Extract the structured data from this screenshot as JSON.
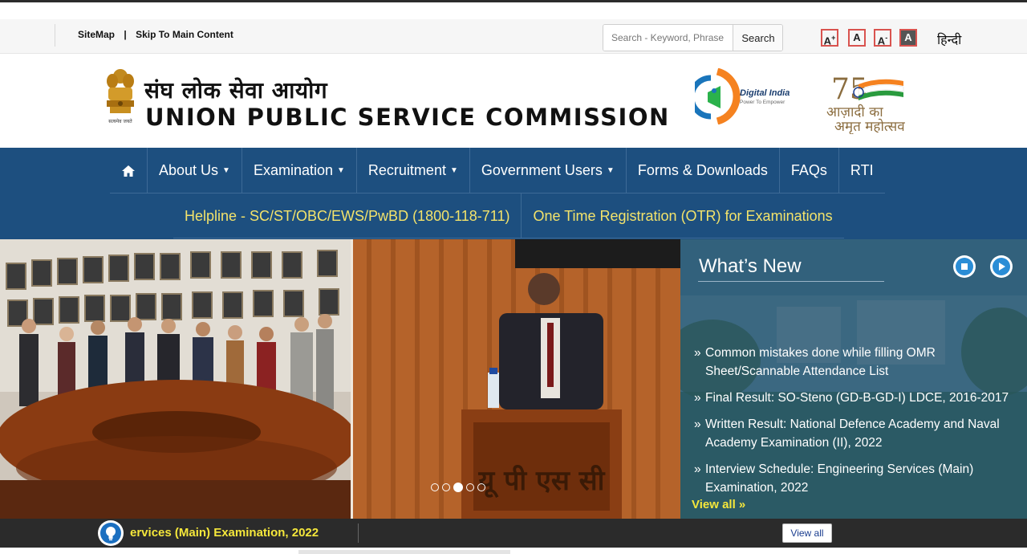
{
  "utility": {
    "sitemap": "SiteMap",
    "pipe": "|",
    "skip": "Skip To Main Content",
    "search_placeholder": "Search - Keyword, Phrase",
    "search_button": "Search",
    "font_inc": "A",
    "font_inc_sup": "+",
    "font_normal": "A",
    "font_dec": "A",
    "font_dec_sup": "-",
    "font_contrast": "A",
    "hindi": "हिन्दी"
  },
  "header": {
    "title_hindi": "संघ लोक सेवा आयोग",
    "title_english": "UNION PUBLIC SERVICE COMMISSION",
    "emblem_caption": "सत्यमेव जयते",
    "digital_india": "Digital India",
    "digital_india_tagline": "Power To Empower",
    "azadi_line1": "आज़ादी का",
    "azadi_line2": "अमृत महोत्सव"
  },
  "nav": {
    "home_icon": "home-icon",
    "items": [
      {
        "label": "About Us",
        "dropdown": true
      },
      {
        "label": "Examination",
        "dropdown": true
      },
      {
        "label": "Recruitment",
        "dropdown": true
      },
      {
        "label": "Government Users",
        "dropdown": true
      },
      {
        "label": "Forms & Downloads",
        "dropdown": false
      },
      {
        "label": "FAQs",
        "dropdown": false
      },
      {
        "label": "RTI",
        "dropdown": false
      }
    ],
    "helpline": "Helpline - SC/ST/OBC/EWS/PwBD (1800-118-711)",
    "otr": "One Time Registration (OTR) for Examinations",
    "secondary_color": "#f3e36b",
    "bg_color": "#1d4f7f"
  },
  "slider": {
    "dots": 5,
    "active_dot": 3,
    "lectern_text": "यू पी एस सी"
  },
  "whats_new": {
    "title": "What’s New",
    "items": [
      "Common mistakes done while filling OMR Sheet/Scannable Attendance List",
      "Final Result: SO-Steno (GD-B-GD-I) LDCE, 2016-2017",
      "Written Result: National Defence Academy and Naval Academy Examination (II), 2022",
      "Interview Schedule: Engineering Services (Main) Examination, 2022"
    ],
    "view_all": "View all »",
    "stop_icon": "stop-icon",
    "play_icon": "play-icon"
  },
  "ticker": {
    "text": "ervices (Main) Examination, 2022",
    "view_all": "View all",
    "icon": "bulb-icon"
  }
}
